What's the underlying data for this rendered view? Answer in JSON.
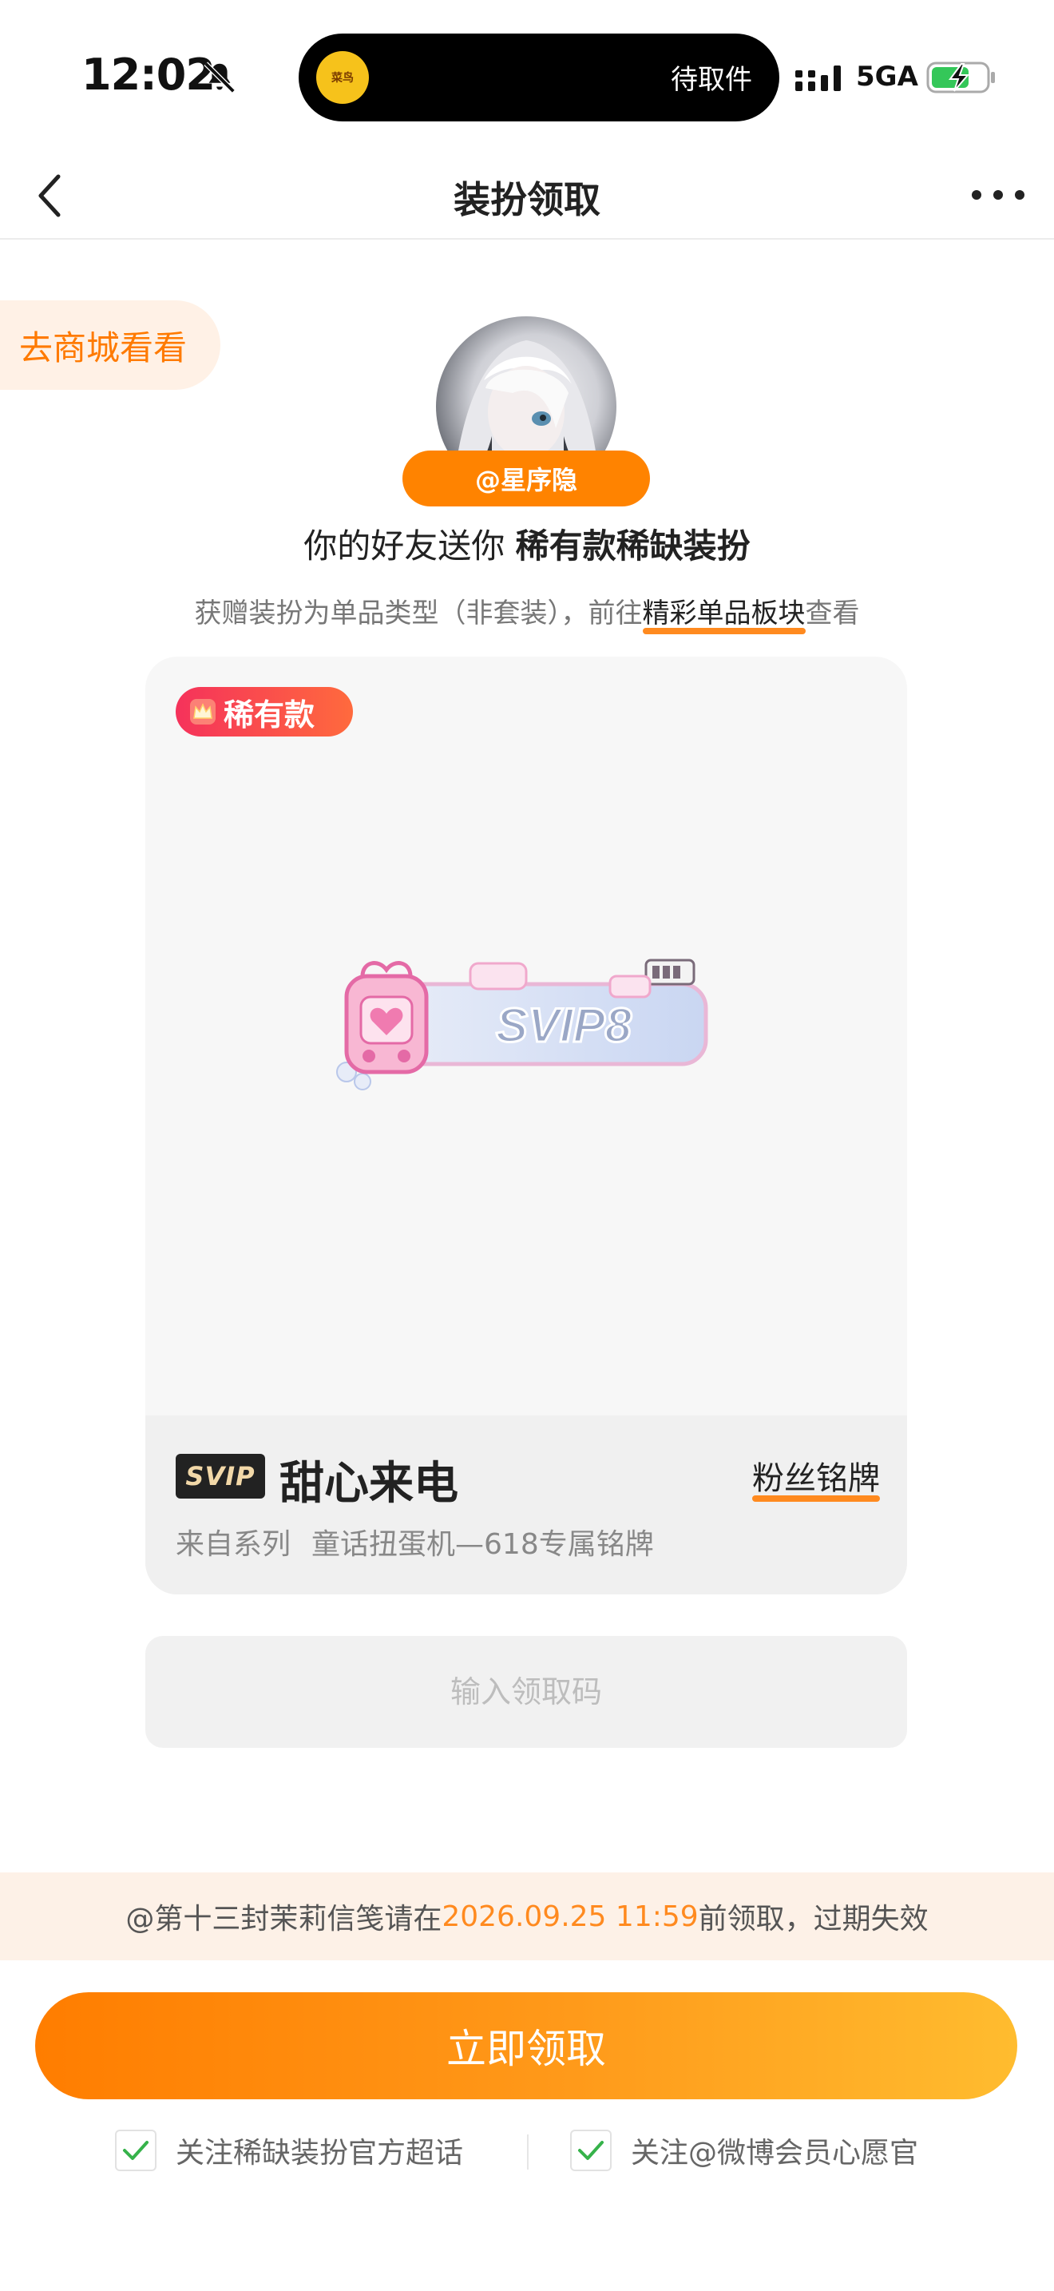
{
  "status_bar": {
    "time": "12:02",
    "island_logo": "菜鸟",
    "island_text": "待取件",
    "network": "5GA",
    "battery": "charging"
  },
  "nav": {
    "title": "装扮领取"
  },
  "store_link": "去商城看看",
  "sender": {
    "handle": "@星序隐"
  },
  "gift": {
    "prefix": "你的好友送你",
    "name": "稀有款稀缺装扮"
  },
  "info": {
    "before": "获赠装扮为单品类型（非套装），前往",
    "link": "精彩单品板块",
    "after": "查看"
  },
  "card": {
    "rarity": "稀有款",
    "badge_art_text": "SVIP8",
    "svip_tag": "SVIP",
    "item_name": "甜心来电",
    "item_type": "粉丝铭牌",
    "series_label": "来自系列",
    "series_name": "童话扭蛋机—618专属铭牌"
  },
  "code_input": {
    "placeholder": "输入领取码",
    "value": ""
  },
  "deadline": {
    "prefix": "@第十三封茉莉信笺请在",
    "date": "2026.09.25 11:59",
    "suffix": "前领取，过期失效"
  },
  "claim_button": "立即领取",
  "follow_options": [
    {
      "label": "关注稀缺装扮官方超话",
      "checked": true
    },
    {
      "label": "关注@微博会员心愿官",
      "checked": true
    }
  ],
  "colors": {
    "accent": "#ff8300",
    "accent_light": "#fff1e6",
    "check_green": "#36b24a"
  }
}
